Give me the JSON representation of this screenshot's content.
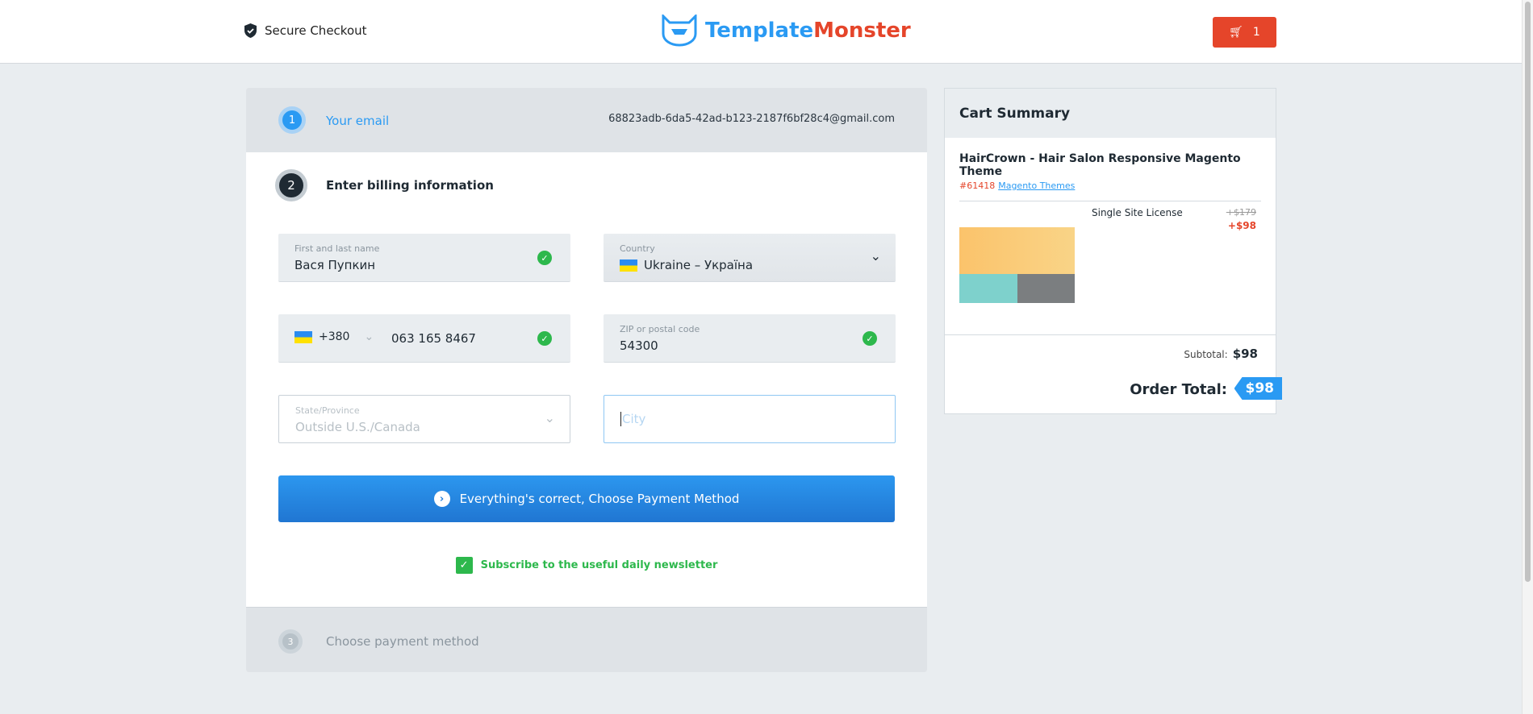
{
  "header": {
    "secure_label": "Secure Checkout",
    "logo_part1": "Template",
    "logo_part2": "Monster",
    "cart_count": "1"
  },
  "step1": {
    "number": "1",
    "label": "Your email",
    "email": "68823adb-6da5-42ad-b123-2187f6bf28c4@gmail.com"
  },
  "step2": {
    "number": "2",
    "label": "Enter billing information",
    "name": {
      "caption": "First and last name",
      "value": "Вася Пупкин"
    },
    "country": {
      "caption": "Country",
      "value": "Ukraine – Україна"
    },
    "phone": {
      "code": "+380",
      "value": "063 165 8467"
    },
    "zip": {
      "caption": "ZIP or postal code",
      "value": "54300"
    },
    "state": {
      "caption": "State/Province",
      "value": "Outside U.S./Canada"
    },
    "city": {
      "placeholder": "City"
    },
    "submit_label": "Everything's correct, Choose Payment Method",
    "newsletter_label": "Subscribe to the useful daily newsletter"
  },
  "step3": {
    "number": "3",
    "label": "Choose payment method"
  },
  "cart": {
    "title": "Cart Summary",
    "product_name": "HairCrown - Hair Salon Responsive Magento Theme",
    "product_id": "#61418",
    "category": "Magento Themes",
    "license": "Single Site License",
    "old_price": "+$179",
    "new_price": "+$98",
    "subtotal_label": "Subtotal:",
    "subtotal": "$98",
    "total_label": "Order Total:",
    "total": "$98"
  }
}
